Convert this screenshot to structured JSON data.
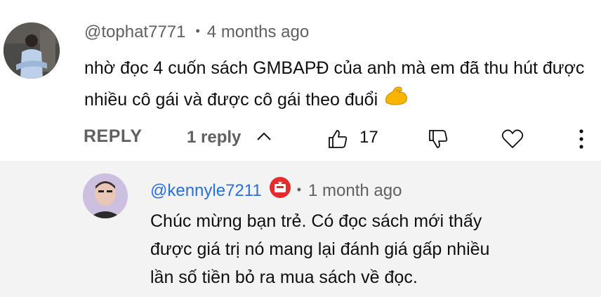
{
  "comment": {
    "author": "@tophat7771",
    "time": "4 months ago",
    "text_line1": "nhờ đọc 4 cuốn sách GMBAPĐ của anh mà em đã thu  hút được",
    "text_line2": "nhiều cô gái và được cô gái theo đuổi",
    "emoji_name": "flexed-biceps-icon",
    "separator": "•"
  },
  "actions": {
    "reply_label": "REPLY",
    "replies_toggle": "1 reply",
    "like_count": "17",
    "icons": [
      "chevron-up-icon",
      "thumbs-up-icon",
      "thumbs-down-icon",
      "heart-icon",
      "more-vertical-icon"
    ]
  },
  "reply": {
    "author": "@kennyle7211",
    "badge": "creator-badge-icon",
    "separator": "•",
    "time": "1 month ago",
    "text_line1": "Chúc mừng bạn trẻ. Có đọc sách mới thấy",
    "text_line2": "được giá trị nó mang lại đánh giá gấp nhiều",
    "text_line3": "lần số tiền bỏ ra mua sách về đọc."
  },
  "colors": {
    "handle_link": "#2a6fdb",
    "muted": "#606060",
    "reply_bg": "#f3f3f3",
    "badge_red": "#e52b2b"
  }
}
